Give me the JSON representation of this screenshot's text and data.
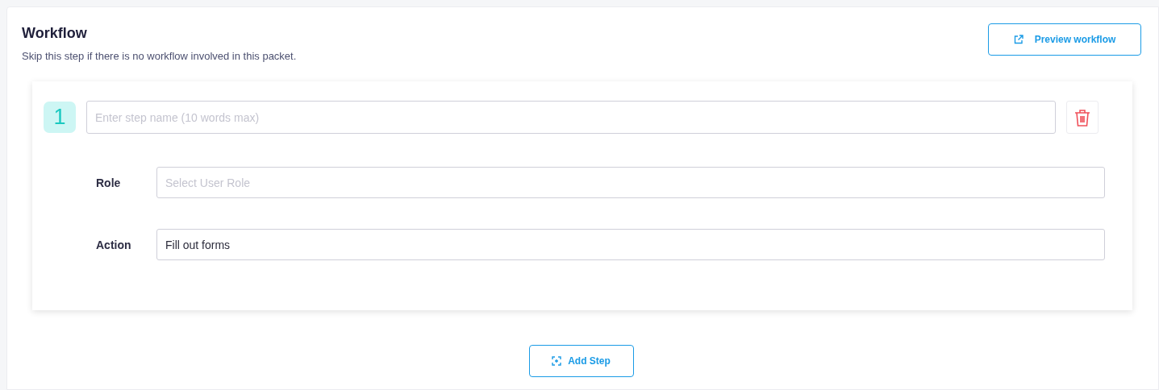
{
  "header": {
    "title": "Workflow",
    "subtitle": "Skip this step if there is no workflow involved in this packet.",
    "preview_button": "Preview workflow"
  },
  "steps": [
    {
      "number": "1",
      "name_placeholder": "Enter step name (10 words max)",
      "fields": [
        {
          "label": "Role",
          "placeholder": "Select User Role"
        },
        {
          "label": "Action",
          "value": "Fill out forms"
        }
      ]
    }
  ],
  "add_button": "Add Step"
}
